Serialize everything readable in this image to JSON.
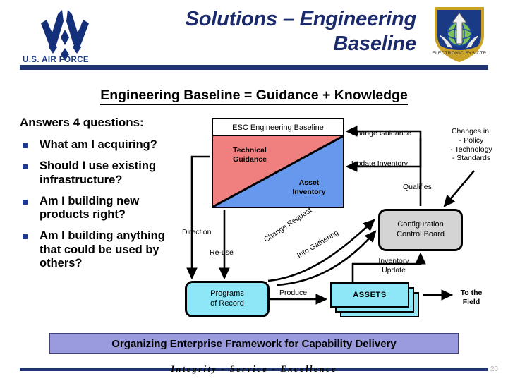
{
  "header": {
    "title_line1": "Solutions – Engineering",
    "title_line2": "Baseline",
    "usaf_wordmark": "U.S. AIR FORCE",
    "usaf_logo_icon": "usaf-wings-logo",
    "esc_emblem_icon": "electronic-systems-center-shield",
    "accent_color": "#1f3470"
  },
  "section": {
    "heading": "Engineering Baseline = Guidance + Knowledge"
  },
  "questions": {
    "lead": "Answers 4 questions:",
    "items": [
      "What am I acquiring?",
      "Should I use existing infrastructure?",
      "Am I building new products right?",
      "Am I building anything that could be used by others?"
    ],
    "bullet_color": "#203a8f"
  },
  "diagram": {
    "esc_box": {
      "title": "ESC Engineering Baseline",
      "guidance_label_line1": "Technical",
      "guidance_label_line2": "Guidance",
      "guidance_color": "#F08080",
      "inventory_label_line1": "Asset",
      "inventory_label_line2": "Inventory",
      "inventory_color": "#6699EE"
    },
    "ccb": {
      "line1": "Configuration",
      "line2": "Control Board",
      "fill": "#d4d4d4"
    },
    "programs_of_record": {
      "line1": "Programs",
      "line2": "of Record",
      "fill": "#8de7f7"
    },
    "assets": {
      "label": "ASSETS",
      "fill": "#8de7f7"
    },
    "changes_in": {
      "title": "Changes in:",
      "items": [
        "- Policy",
        "- Technology",
        "- Standards"
      ]
    },
    "labels": {
      "change_guidance": "Change Guidance",
      "update_inventory": "Update Inventory",
      "qualifies": "Qualifies",
      "direction": "Direction",
      "reuse": "Re-use",
      "change_request": "Change Request",
      "info_gathering": "Info Gathering",
      "produce": "Produce",
      "inventory": "Inventory",
      "update": "Update",
      "to_the_field_line1": "To the",
      "to_the_field_line2": "Field"
    }
  },
  "footer": {
    "banner": "Organizing Enterprise Framework for Capability Delivery",
    "banner_fill": "#9a9ade",
    "tagline": "Integrity - Service - Excellence",
    "page_number": "20"
  }
}
